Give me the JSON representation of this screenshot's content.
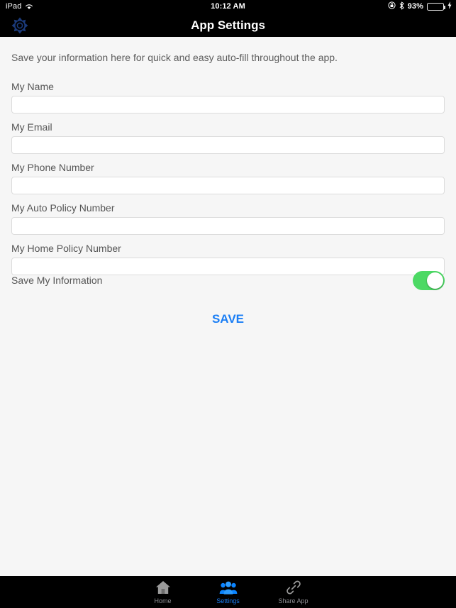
{
  "status_bar": {
    "carrier": "iPad",
    "wifi_icon": "wifi-icon",
    "time": "10:12 AM",
    "rotation_lock_icon": "rotation-lock-icon",
    "bluetooth_icon": "bluetooth-icon",
    "battery_percent": "93%",
    "battery_level": 93,
    "battery_icon": "battery-icon",
    "charging_icon": "charging-bolt-icon"
  },
  "nav_bar": {
    "title": "App Settings",
    "gear_icon": "gear-icon"
  },
  "content": {
    "intro": "Save your information here for quick and easy auto-fill throughout the app.",
    "fields": [
      {
        "label": "My Name",
        "value": "",
        "placeholder": ""
      },
      {
        "label": "My Email",
        "value": "",
        "placeholder": ""
      },
      {
        "label": "My Phone Number",
        "value": "",
        "placeholder": ""
      },
      {
        "label": "My Auto Policy Number",
        "value": "",
        "placeholder": ""
      },
      {
        "label": "My Home Policy Number",
        "value": "",
        "placeholder": ""
      }
    ],
    "toggle": {
      "label": "Save My Information",
      "state": "on"
    },
    "save_label": "SAVE"
  },
  "tab_bar": {
    "tabs": [
      {
        "label": "Home",
        "icon": "home-icon",
        "active": false
      },
      {
        "label": "Settings",
        "icon": "people-group-icon",
        "active": true
      },
      {
        "label": "Share App",
        "icon": "chain-link-icon",
        "active": false
      }
    ]
  },
  "colors": {
    "accent_blue": "#1a7ef5",
    "toggle_green": "#4cd964",
    "bar_black": "#000000",
    "page_background": "#f6f6f6",
    "label_gray": "#555555",
    "inactive_tab_gray": "#8e8e93"
  }
}
